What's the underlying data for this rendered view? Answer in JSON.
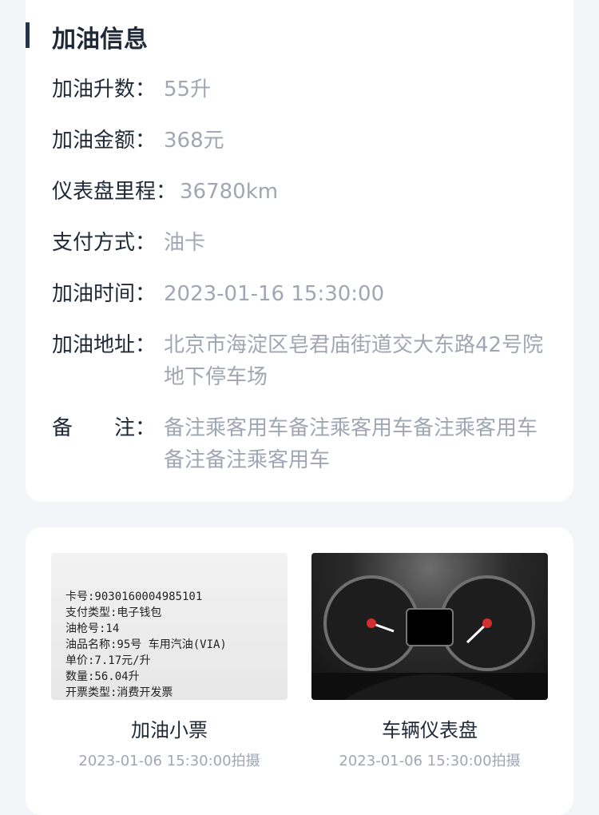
{
  "fuel_info": {
    "title": "加油信息",
    "rows": [
      {
        "label": "加油升数：",
        "value": "55升"
      },
      {
        "label": "加油金额：",
        "value": "368元"
      },
      {
        "label": "仪表盘里程：",
        "value": "36780km"
      },
      {
        "label": "支付方式：",
        "value": "油卡"
      },
      {
        "label": "加油时间：",
        "value": "2023-01-16 15:30:00"
      },
      {
        "label": "加油地址：",
        "value": "北京市海淀区皂君庙街道交大东路42号院地下停车场"
      },
      {
        "label": "备　　注：",
        "value": "备注乘客用车备注乘客用车备注乘客用车备注备注乘客用车"
      }
    ]
  },
  "photos": {
    "receipt": {
      "caption": "加油小票",
      "time": "2023-01-06 15:30:00拍摄",
      "receipt_text": [
        "卡号:9030160004985101",
        "支付类型:电子钱包",
        "油枪号:14",
        "油品名称:95号 车用汽油(VIA)",
        "单价:7.17元/升",
        "数量:56.04升",
        "开票类型:消费开发票"
      ]
    },
    "dashboard": {
      "caption": "车辆仪表盘",
      "time": "2023-01-06 15:30:00拍摄"
    }
  },
  "colors": {
    "title_bar": "#273447",
    "label": "#1f2937",
    "value": "#a0a6b3",
    "background": "#f4f5f8",
    "card": "#ffffff"
  }
}
